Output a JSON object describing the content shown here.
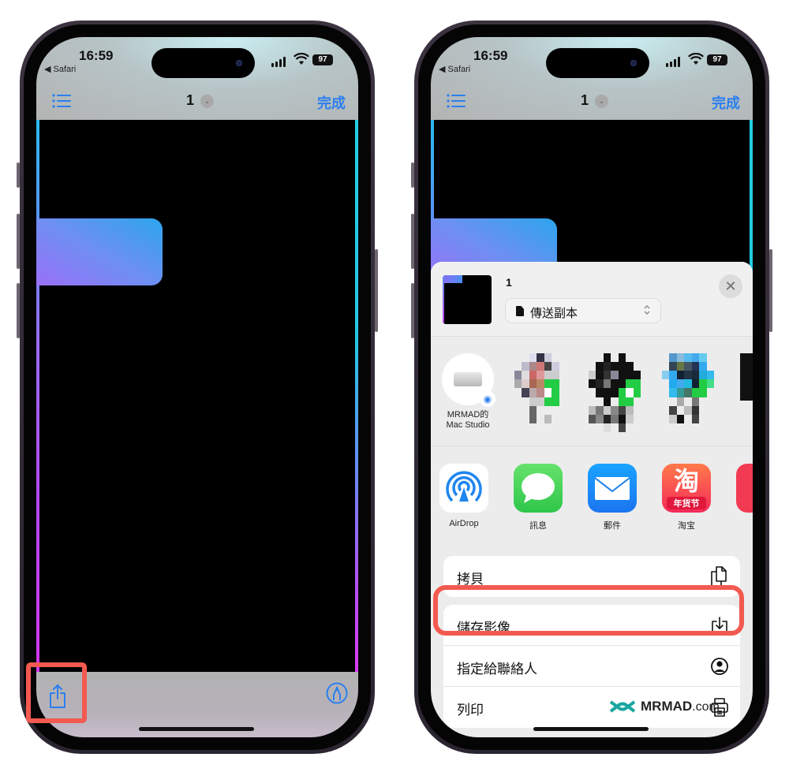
{
  "status_bar": {
    "time": "16:59",
    "back_app": "◀ Safari",
    "battery": "97"
  },
  "nav": {
    "page_number": "1",
    "chevron": "⌄",
    "done_label": "完成"
  },
  "share_sheet": {
    "title": "1",
    "option_label": "傳送副本",
    "option_updown": "⌃⌄",
    "close_glyph": "✕",
    "people": [
      {
        "name_line1": "MRMAD的",
        "name_line2": "Mac Studio"
      },
      {
        "name_line1": "",
        "name_line2": ""
      },
      {
        "name_line1": "",
        "name_line2": ""
      },
      {
        "name_line1": "",
        "name_line2": ""
      }
    ],
    "apps": [
      {
        "name": "AirDrop"
      },
      {
        "name": "訊息"
      },
      {
        "name": "郵件"
      },
      {
        "name": "淘宝",
        "icon_text": "淘",
        "icon_sub": "年货节"
      },
      {
        "name": ""
      }
    ],
    "actions": [
      {
        "label": "拷貝",
        "icon": "copy-icon"
      },
      {
        "label": "儲存影像",
        "icon": "save-download-icon"
      },
      {
        "label": "指定給聯絡人",
        "icon": "contact-icon"
      },
      {
        "label": "列印",
        "icon": "printer-icon"
      }
    ]
  },
  "watermark": {
    "brand": "MRMAD",
    "suffix": ".com"
  },
  "colors": {
    "accent_blue": "#2b7ff0",
    "highlight_red": "#f25a50"
  }
}
